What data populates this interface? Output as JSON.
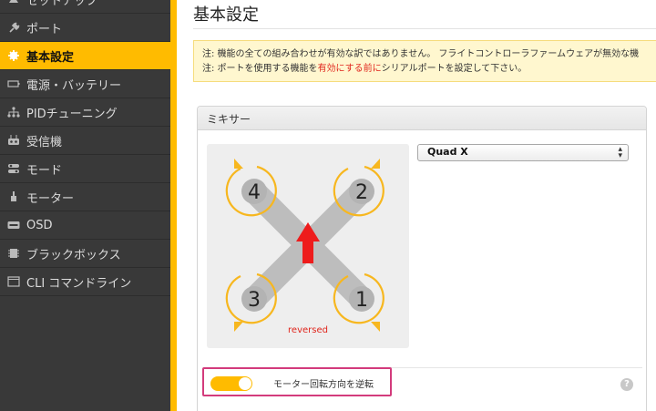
{
  "sidebar": {
    "items": [
      {
        "label": "セットアップ",
        "icon": "setup-icon",
        "active": false
      },
      {
        "label": "ポート",
        "icon": "plug-icon",
        "active": false
      },
      {
        "label": "基本設定",
        "icon": "gear-icon",
        "active": true
      },
      {
        "label": "電源・バッテリー",
        "icon": "battery-icon",
        "active": false
      },
      {
        "label": "PIDチューニング",
        "icon": "pid-icon",
        "active": false
      },
      {
        "label": "受信機",
        "icon": "receiver-icon",
        "active": false
      },
      {
        "label": "モード",
        "icon": "modes-icon",
        "active": false
      },
      {
        "label": "モーター",
        "icon": "motor-icon",
        "active": false
      },
      {
        "label": "OSD",
        "icon": "osd-icon",
        "active": false
      },
      {
        "label": "ブラックボックス",
        "icon": "blackbox-icon",
        "active": false
      },
      {
        "label": "CLI コマンドライン",
        "icon": "cli-icon",
        "active": false
      }
    ]
  },
  "main": {
    "title": "基本設定",
    "note": {
      "line1": "注: 機能の全ての組み合わせが有効な訳ではありません。 フライトコントローラファームウェアが無効な機",
      "line2_pre": "注: ポートを使用する機能を",
      "line2_red": "有効にする前に",
      "line2_post": "シリアルポートを設定して下さい。"
    },
    "mixer": {
      "header": "ミキサー",
      "selected": "Quad X",
      "motors": [
        "4",
        "2",
        "3",
        "1"
      ],
      "reversed_label": "reversed",
      "toggle_label": "モーター回転方向を逆転",
      "toggle_on": true,
      "help": "?"
    }
  },
  "colors": {
    "accent": "#ffbb00",
    "sidebar_bg": "#393939",
    "highlight": "#d33b7c",
    "warning_red": "#e0261d"
  }
}
